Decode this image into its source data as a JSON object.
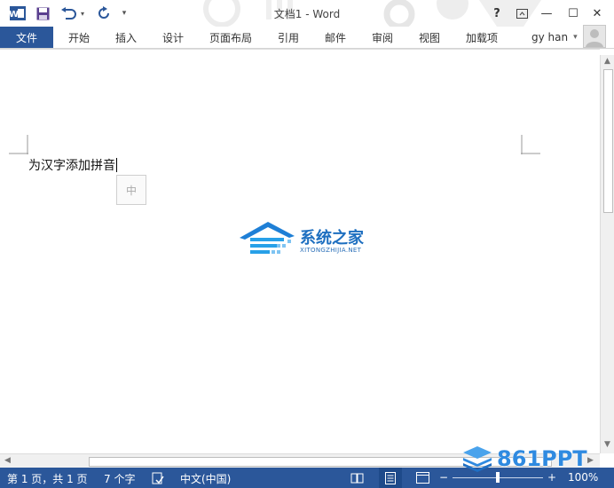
{
  "window": {
    "title": "文档1 - Word",
    "help": "?",
    "buttons": {
      "minimize": "—",
      "maximize": "☐",
      "close": "✕"
    }
  },
  "quick_access": {
    "customize": "▾"
  },
  "ribbon": {
    "file_tab": "文件",
    "tabs": [
      "开始",
      "插入",
      "设计",
      "页面布局",
      "引用",
      "邮件",
      "审阅",
      "视图",
      "加载项"
    ],
    "user_name": "gy han",
    "user_menu": "▾"
  },
  "document": {
    "text": "为汉字添加拼音",
    "ime_indicator": "中"
  },
  "watermark": {
    "brand": "系统之家",
    "site": "XITONGZHIJIA.NET"
  },
  "status_bar": {
    "page": "第 1 页，共 1 页",
    "word_count": "7 个字",
    "language": "中文(中国)",
    "zoom": "100%",
    "zoom_minus": "−",
    "zoom_plus": "+"
  },
  "overlay_logo": {
    "text": "861PPT"
  },
  "colors": {
    "accent": "#2b579a",
    "watermark_blue": "#1e6fc0",
    "logo_blue": "#2f8ae0"
  }
}
